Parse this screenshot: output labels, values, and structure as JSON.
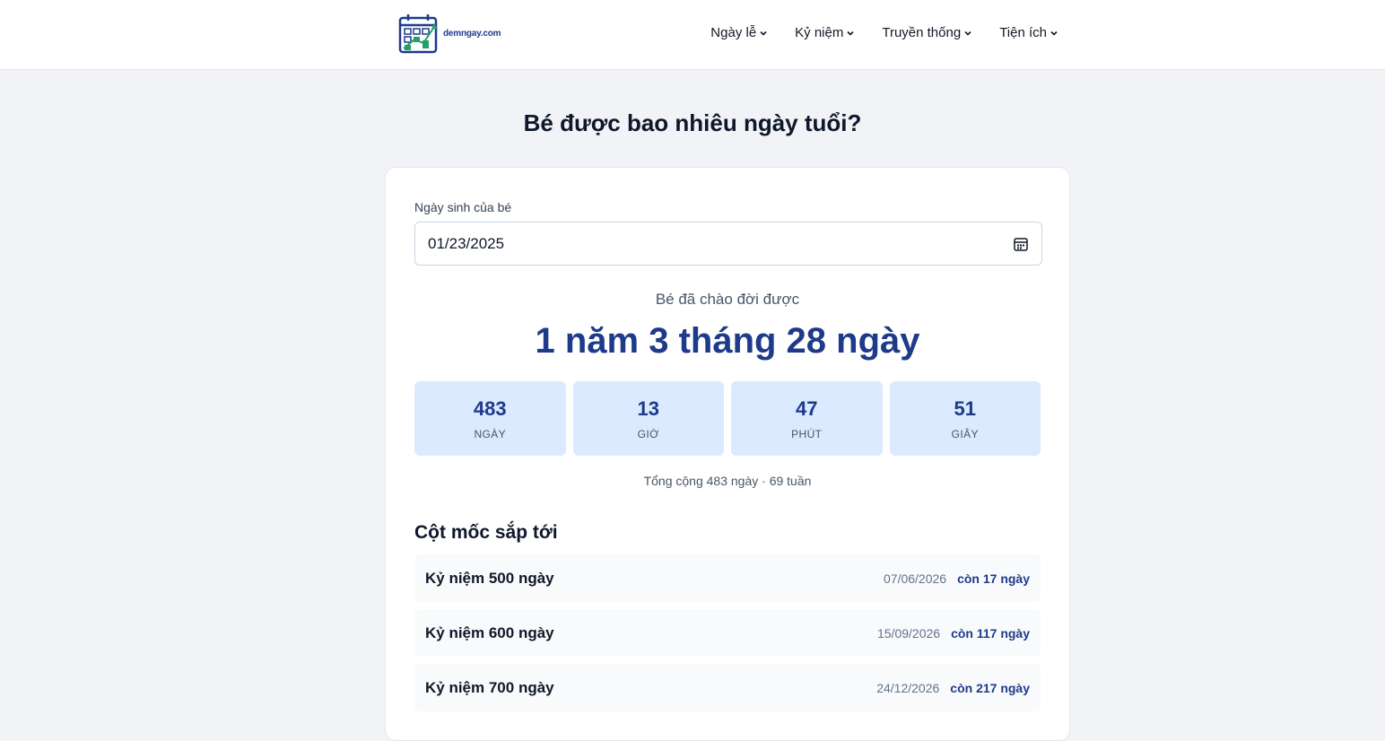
{
  "brand": {
    "logo_text": "demngay.com"
  },
  "nav": [
    {
      "label": "Ngày lễ"
    },
    {
      "label": "Kỷ niệm"
    },
    {
      "label": "Truyền thống"
    },
    {
      "label": "Tiện ích"
    }
  ],
  "page": {
    "title": "Bé được bao nhiêu ngày tuổi?"
  },
  "form": {
    "birth_label": "Ngày sinh của bé",
    "birth_value": "01/23/2025"
  },
  "result": {
    "intro": "Bé đã chào đời được",
    "age_text": "1 năm 3 tháng 28 ngày",
    "stats": [
      {
        "value": "483",
        "label": "NGÀY"
      },
      {
        "value": "13",
        "label": "GIỜ"
      },
      {
        "value": "47",
        "label": "PHÚT"
      },
      {
        "value": "51",
        "label": "GIÂY"
      }
    ],
    "total_text": "Tổng cộng 483 ngày · 69 tuần"
  },
  "milestones": {
    "title": "Cột mốc sắp tới",
    "items": [
      {
        "name": "Kỷ niệm 500 ngày",
        "date": "07/06/2026",
        "remaining": "còn 17 ngày"
      },
      {
        "name": "Kỷ niệm 600 ngày",
        "date": "15/09/2026",
        "remaining": "còn 117 ngày"
      },
      {
        "name": "Kỷ niệm 700 ngày",
        "date": "24/12/2026",
        "remaining": "còn 217 ngày"
      }
    ]
  },
  "colors": {
    "accent": "#1e3a8a",
    "stat_bg": "#dbeafe",
    "page_bg": "#f1f3f7"
  },
  "icons": {
    "logo": "calendar-chart-icon",
    "date_picker": "calendar-icon",
    "nav_dropdown": "chevron-down-icon"
  }
}
